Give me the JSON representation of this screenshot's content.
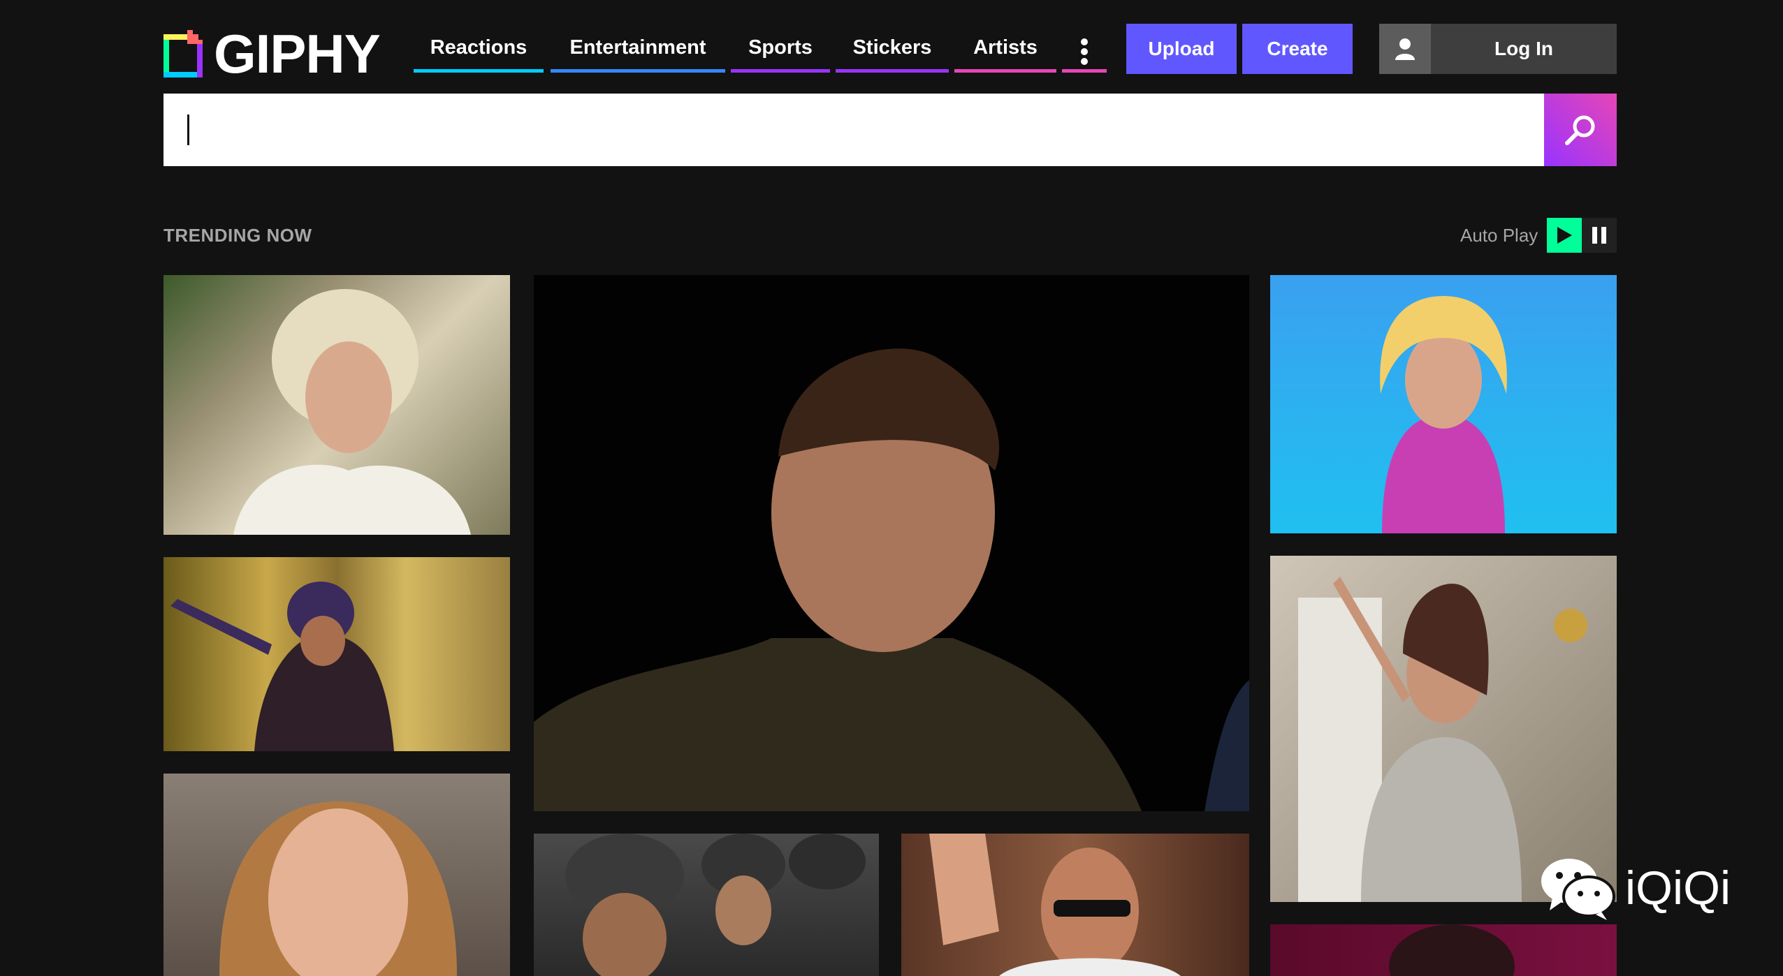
{
  "header": {
    "logo_text": "GIPHY",
    "nav": [
      {
        "label": "Reactions",
        "color": "#00ccff"
      },
      {
        "label": "Entertainment",
        "color": "#3388ff"
      },
      {
        "label": "Sports",
        "color": "#9933ff"
      },
      {
        "label": "Stickers",
        "color": "#9933ff"
      },
      {
        "label": "Artists",
        "color": "#e646b6"
      }
    ],
    "more_icon": "vertical-ellipsis-icon",
    "upload_label": "Upload",
    "create_label": "Create",
    "login_label": "Log In",
    "user_icon": "user-icon",
    "colors": {
      "upload": "#6157ff",
      "create": "#6157ff",
      "login": "#3e3e3e",
      "login_icon_bg": "#5c5c5c"
    }
  },
  "search": {
    "placeholder": "",
    "value": "",
    "button_icon": "search-icon"
  },
  "trending": {
    "title": "TRENDING NOW",
    "autoplay_label": "Auto Play",
    "play_icon": "play-icon",
    "pause_icon": "pause-icon"
  },
  "watermark": {
    "text": "iQiQi",
    "icon": "wechat-icon"
  }
}
